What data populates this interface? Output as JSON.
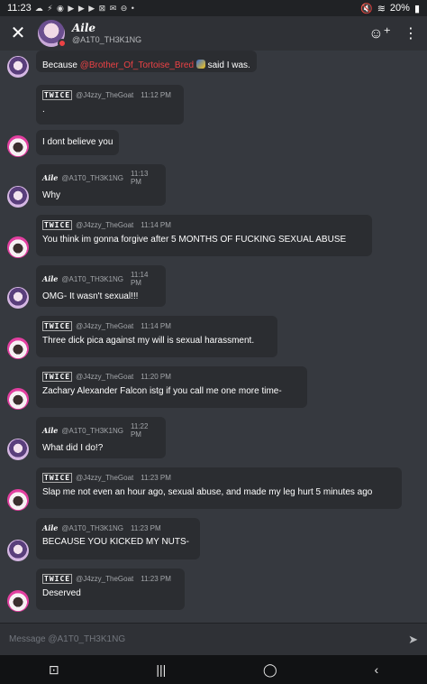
{
  "status_bar": {
    "time": "11:23",
    "left_icons": "☁ ⚡ ◉ ▶ ▶ ▶ ⊠ ✉ ⊖ •",
    "battery": "20%"
  },
  "header": {
    "display_name": "Aile",
    "username": "@A1T0_TH3K1NG"
  },
  "messages": [
    {
      "author": "",
      "author_style": "aile",
      "username": "",
      "time": "",
      "text": "Because ",
      "mention": "@Brother_Of_Tortoise_Bred",
      "text_after": " said I was."
    },
    {
      "author": "TWICE",
      "author_style": "twice",
      "username": "@J4zzy_TheGoat",
      "time": "11:12 PM",
      "text": "."
    },
    {
      "author": "",
      "author_style": "twice",
      "username": "",
      "time": "",
      "text": "I dont believe you"
    },
    {
      "author": "Aile",
      "author_style": "aile",
      "username": "@A1T0_TH3K1NG",
      "time": "11:13 PM",
      "text": "Why"
    },
    {
      "author": "TWICE",
      "author_style": "twice",
      "username": "@J4zzy_TheGoat",
      "time": "11:14 PM",
      "text": "You think im gonna forgive after 5 MONTHS OF FUCKING SEXUAL ABUSE"
    },
    {
      "author": "Aile",
      "author_style": "aile",
      "username": "@A1T0_TH3K1NG",
      "time": "11:14 PM",
      "text": "OMG- It wasn't sexual!!!"
    },
    {
      "author": "TWICE",
      "author_style": "twice",
      "username": "@J4zzy_TheGoat",
      "time": "11:14 PM",
      "text": "Three dick pica against my will is sexual harassment."
    },
    {
      "author": "TWICE",
      "author_style": "twice",
      "username": "@J4zzy_TheGoat",
      "time": "11:20 PM",
      "text": "Zachary Alexander Falcon istg if you call me one more time-"
    },
    {
      "author": "Aile",
      "author_style": "aile",
      "username": "@A1T0_TH3K1NG",
      "time": "11:22 PM",
      "text": "What did I do!?"
    },
    {
      "author": "TWICE",
      "author_style": "twice",
      "username": "@J4zzy_TheGoat",
      "time": "11:23 PM",
      "text": "Slap me not even an hour ago, sexual abuse, and made my leg hurt 5 minutes ago"
    },
    {
      "author": "Aile",
      "author_style": "aile",
      "username": "@A1T0_TH3K1NG",
      "time": "11:23 PM",
      "text": "BECAUSE YOU KICKED MY NUTS-"
    },
    {
      "author": "TWICE",
      "author_style": "twice",
      "username": "@J4zzy_TheGoat",
      "time": "11:23 PM",
      "text": "Deserved"
    }
  ],
  "composer": {
    "placeholder": "Message @A1T0_TH3K1NG"
  },
  "nav": {
    "recents": "|||",
    "home": "◯",
    "back": "‹"
  },
  "colors": {
    "background": "#36393f",
    "bubble": "#2b2d31",
    "mention": "#ed4245",
    "status_dnd": "#ed4245"
  }
}
